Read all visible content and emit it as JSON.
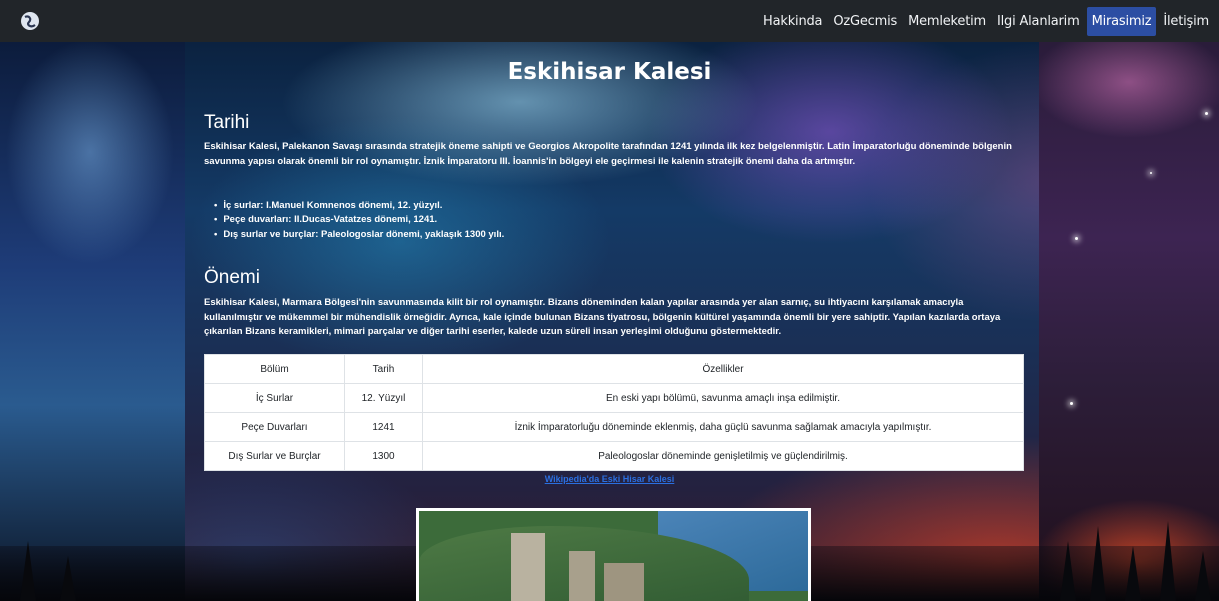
{
  "nav": {
    "links": [
      "Hakkinda",
      "OzGecmis",
      "Memleketim",
      "Ilgi Alanlarim",
      "Mirasimiz",
      "İletişim"
    ],
    "active_index": 4,
    "active_color": "#2c4ea3"
  },
  "page": {
    "title": "Eskihisar Kalesi"
  },
  "tarihi": {
    "heading": "Tarihi",
    "text": "Eskihisar Kalesi, Palekanon Savaşı sırasında stratejik öneme sahipti ve Georgios Akropolite tarafından 1241 yılında ilk kez belgelenmiştir. Latin İmparatorluğu döneminde bölgenin savunma yapısı olarak önemli bir rol oynamıştır. İznik İmparatoru III. İoannis'in bölgeyi ele geçirmesi ile kalenin stratejik önemi daha da artmıştır.",
    "items": [
      "İç surlar: I.Manuel Komnenos dönemi, 12. yüzyıl.",
      "Peçe duvarları: II.Ducas-Vatatzes dönemi, 1241.",
      "Dış surlar ve burçlar: Paleologoslar dönemi, yaklaşık 1300 yılı."
    ]
  },
  "onemi": {
    "heading": "Önemi",
    "text": "Eskihisar Kalesi, Marmara Bölgesi'nin savunmasında kilit bir rol oynamıştır. Bizans döneminden kalan yapılar arasında yer alan sarnıç, su ihtiyacını karşılamak amacıyla kullanılmıştır ve mükemmel bir mühendislik örneğidir. Ayrıca, kale içinde bulunan Bizans tiyatrosu, bölgenin kültürel yaşamında önemli bir yere sahiptir. Yapılan kazılarda ortaya çıkarılan Bizans keramikleri, mimari parçalar ve diğer tarihi eserler, kalede uzun süreli insan yerleşimi olduğunu göstermektedir."
  },
  "table": {
    "headers": [
      "Bölüm",
      "Tarih",
      "Özellikler"
    ],
    "rows": [
      [
        "İç Surlar",
        "12. Yüzyıl",
        "En eski yapı bölümü, savunma amaçlı inşa edilmiştir."
      ],
      [
        "Peçe Duvarları",
        "1241",
        "İznik İmparatorluğu döneminde eklenmiş, daha güçlü savunma sağlamak amacıyla yapılmıştır."
      ],
      [
        "Dış Surlar ve Burçlar",
        "1300",
        "Paleologoslar döneminde genişletilmiş ve güçlendirilmiş."
      ]
    ]
  },
  "link": {
    "label": "Wikipedia'da Eski Hisar Kalesi",
    "color": "#2b6fe0"
  }
}
